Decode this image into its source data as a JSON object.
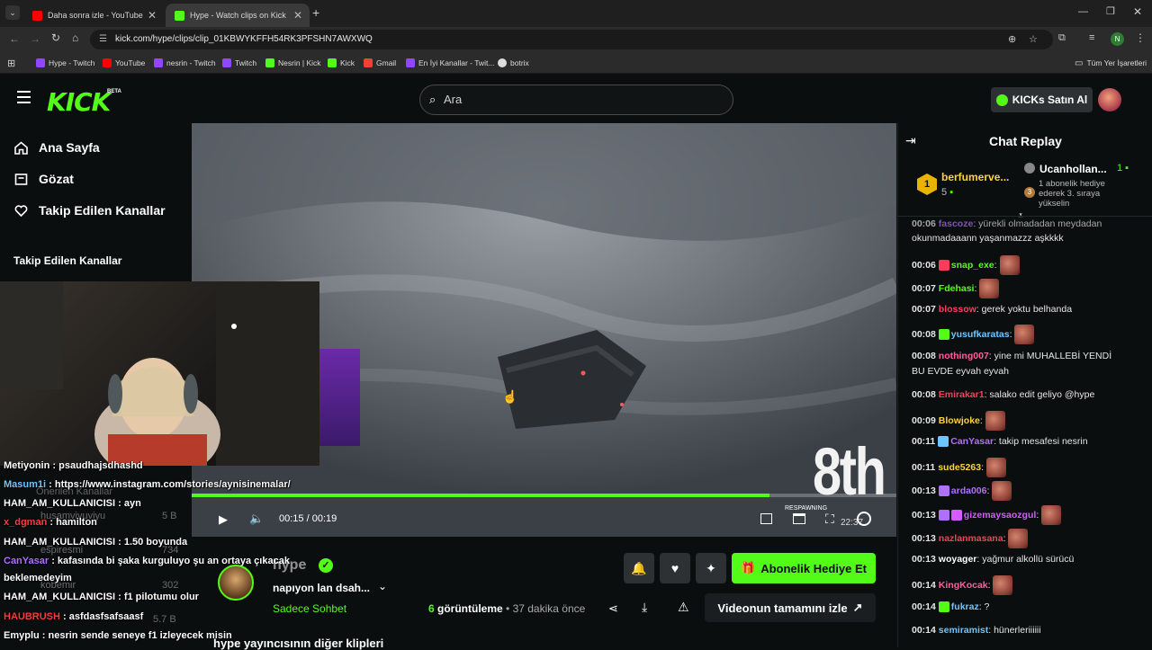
{
  "browser": {
    "tabs": [
      {
        "title": "Daha sonra izle - YouTube",
        "favicon_color": "#ff0000"
      },
      {
        "title": "Hype - Watch clips on Kick",
        "favicon_color": "#53fc18"
      }
    ],
    "url": "kick.com/hype/clips/clip_01KBWYKFFH54RK3PFSHN7AWXWQ",
    "bookmarks": [
      "Hype - Twitch",
      "YouTube",
      "nesrin - Twitch",
      "Twitch",
      "Nesrin | Kick",
      "Kick",
      "Gmail",
      "En İyi Kanallar - Twit...",
      "botrix"
    ],
    "all_bookmarks": "Tüm Yer İşaretleri",
    "profile_initial": "N"
  },
  "header": {
    "logo": "KICK",
    "beta": "BETA",
    "search_placeholder": "Ara",
    "kicks_button": "KICKs Satın Al"
  },
  "nav": {
    "items": [
      "Ana Sayfa",
      "Gözat",
      "Takip Edilen Kanallar"
    ],
    "section_title": "Takip Edilen Kanallar",
    "faint_items": [
      "Önerilen Kanallar",
      "husamviyuviyu",
      "5 B",
      "espiresmi",
      "734",
      "kobemir",
      "302",
      "5.7 B"
    ]
  },
  "player": {
    "placement": "8th",
    "current_time": "00:15",
    "separator": "/",
    "duration": "00:19",
    "progress": 0.82,
    "hud_text": "RESPAWNING",
    "hud_timer": "22:37"
  },
  "stream_overlay_chat": [
    {
      "user": "Metiyonin",
      "text": " : psaudhajsdhashd",
      "color": "#ffffff"
    },
    {
      "user": "Masum1i",
      "text": " : https://www.instagram.com/stories/aynisinemalar/",
      "color": "#6ec6ff"
    },
    {
      "user": "HAM_AM_KULLANICISI",
      "text": " : ayn",
      "color": "#ffffff"
    },
    {
      "user": "x_dgman",
      "text": " : hamilton",
      "color": "#ff3b3b"
    },
    {
      "user": "HAM_AM_KULLANICISI",
      "text": " : 1.50 boyunda",
      "color": "#ffffff"
    },
    {
      "user": "CanYasar",
      "text": " : kafasında bi şaka kurguluyo şu an ortaya çıkacak",
      "color": "#b070ff"
    },
    {
      "user": "",
      "text": "beklemedeyim",
      "color": "#ffffff"
    },
    {
      "user": "HAM_AM_KULLANICISI",
      "text": " : f1 pilotumu olur",
      "color": "#ffffff"
    },
    {
      "user": "HAUBRUSH",
      "text": " : asfdasfsafsaasf",
      "color": "#ff3b3b"
    },
    {
      "user": "Emyplu",
      "text": " : nesrin sende seneye f1 izleyecek misin",
      "color": "#ffffff"
    }
  ],
  "clip_info": {
    "channel": "hype",
    "title": "napıyon lan dsah...",
    "category": "Sadece Sohbet",
    "views_count": "6",
    "views_label": " görüntüleme",
    "time_ago": " • 37 dakika önce",
    "footer": "hype yayıncısının diğer klipleri"
  },
  "actions": {
    "sub_gift": "Abonelik Hediye Et",
    "watch_full": "Videonun tamamını izle"
  },
  "chat": {
    "title": "Chat Replay",
    "leader1": {
      "name": "berfumerve...",
      "rank": "1",
      "count": "5"
    },
    "leader2": {
      "name": "Ucanhollan...",
      "count": "1",
      "desc": "1 abonelik hediye ederek 3. sıraya yükselin",
      "rank": "3"
    },
    "messages": [
      {
        "time": "00:06",
        "user": "fascoze",
        "text": ": yürekli olmadadan meydadan",
        "color": "#b070ff",
        "emote": false
      },
      {
        "time": "",
        "user": "",
        "text": "okunmadaaann yaşanmazzz aşkkkk",
        "color": "#fff",
        "emote": false
      },
      {
        "time": "00:06",
        "user": "snap_exe",
        "text": ":",
        "color": "#53fc18",
        "emote": true
      },
      {
        "time": "00:07",
        "user": "Fdehasi",
        "text": ":",
        "color": "#53fc18",
        "emote": true
      },
      {
        "time": "00:07",
        "user": "blossow",
        "text": ": gerek yoktu belhanda",
        "color": "#ff3b5c",
        "emote": false
      },
      {
        "time": "00:08",
        "user": "yusufkaratas",
        "text": ":",
        "color": "#6ec6ff",
        "emote": true
      },
      {
        "time": "00:08",
        "user": "nothing007",
        "text": ": yine mi MUHALLEBİ YENDİ",
        "color": "#ff5f9e",
        "emote": false
      },
      {
        "time": "",
        "user": "",
        "text": "BU EVDE eyvah eyvah",
        "color": "#fff",
        "emote": false
      },
      {
        "time": "00:08",
        "user": "Emirakar1",
        "text": ": salako edit geliyo @hype",
        "color": "#ff3b5c",
        "emote": false
      },
      {
        "time": "00:09",
        "user": "Blowjoke",
        "text": ":",
        "color": "#ffd23b",
        "emote": true
      },
      {
        "time": "00:11",
        "user": "CanYasar",
        "text": ": takip mesafesi nesrin",
        "color": "#b070ff",
        "emote": false
      },
      {
        "time": "00:11",
        "user": "sude5263",
        "text": ":",
        "color": "#ffd23b",
        "emote": true
      },
      {
        "time": "00:13",
        "user": "arda006",
        "text": ":",
        "color": "#b070ff",
        "emote": true
      },
      {
        "time": "00:13",
        "user": "gizemaysaozgul",
        "text": ":",
        "color": "#d45cff",
        "emote": true
      },
      {
        "time": "00:13",
        "user": "nazlanmasana",
        "text": ":",
        "color": "#ff3b5c",
        "emote": true
      },
      {
        "time": "00:13",
        "user": "woyager",
        "text": ": yağmur alkollü sürücü",
        "color": "#ffffff",
        "emote": false
      },
      {
        "time": "00:14",
        "user": "KingKocak",
        "text": ":",
        "color": "#ff5f9e",
        "emote": true
      },
      {
        "time": "00:14",
        "user": "fukraz",
        "text": ": ?",
        "color": "#6ec6ff",
        "emote": false
      },
      {
        "time": "00:14",
        "user": "semiramist",
        "text": ": hünerleriiiiii",
        "color": "#6ec6ff",
        "emote": false
      }
    ]
  },
  "colors": {
    "brand": "#53fc18",
    "bg": "#0b0e0f"
  }
}
